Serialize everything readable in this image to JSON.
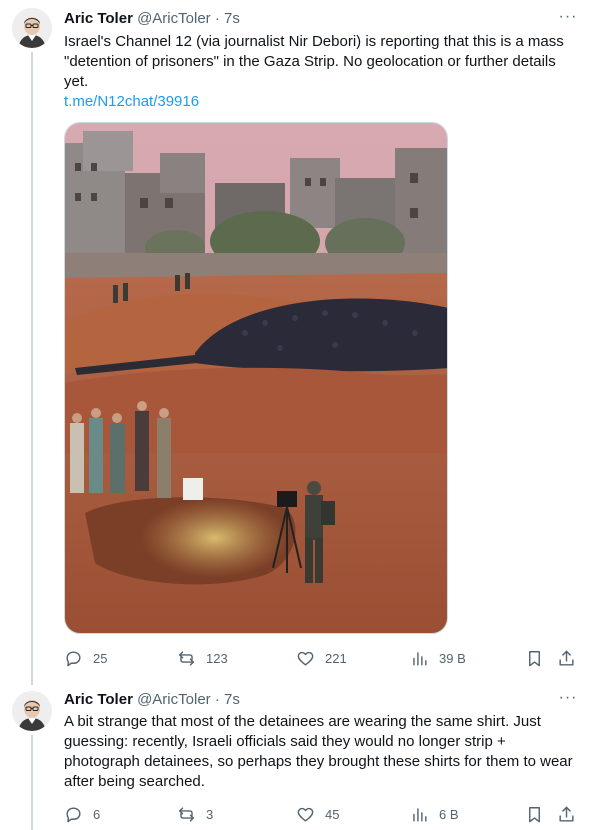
{
  "tweets": [
    {
      "author": {
        "name": "Aric Toler",
        "handle": "@AricToler"
      },
      "separator": "·",
      "time": "7s",
      "text": "Israel's Channel 12 (via journalist Nir Debori) is reporting that this is a mass \"detention of prisoners\" in the Gaza Strip. No geolocation or further details yet.",
      "link": "t.me/N12chat/39916",
      "stats": {
        "replies": "25",
        "reposts": "123",
        "likes": "221",
        "views": "39 B"
      }
    },
    {
      "author": {
        "name": "Aric Toler",
        "handle": "@AricToler"
      },
      "separator": "·",
      "time": "7s",
      "text": "A bit strange that most of the detainees are wearing the same shirt. Just guessing: recently, Israeli officials said they would no longer strip + photograph detainees, so perhaps they brought these shirts for them to wear after being searched.",
      "stats": {
        "replies": "6",
        "reposts": "3",
        "likes": "45",
        "views": "6 B"
      }
    }
  ],
  "icons": {
    "more": "more-dots-icon",
    "reply": "reply-icon",
    "repost": "repost-icon",
    "like": "heart-icon",
    "views": "views-bar-icon",
    "bookmark": "bookmark-icon",
    "share": "share-icon"
  },
  "colors": {
    "link": "#1d9bf0",
    "secondary_text": "#536471",
    "border": "#cfd9de"
  }
}
